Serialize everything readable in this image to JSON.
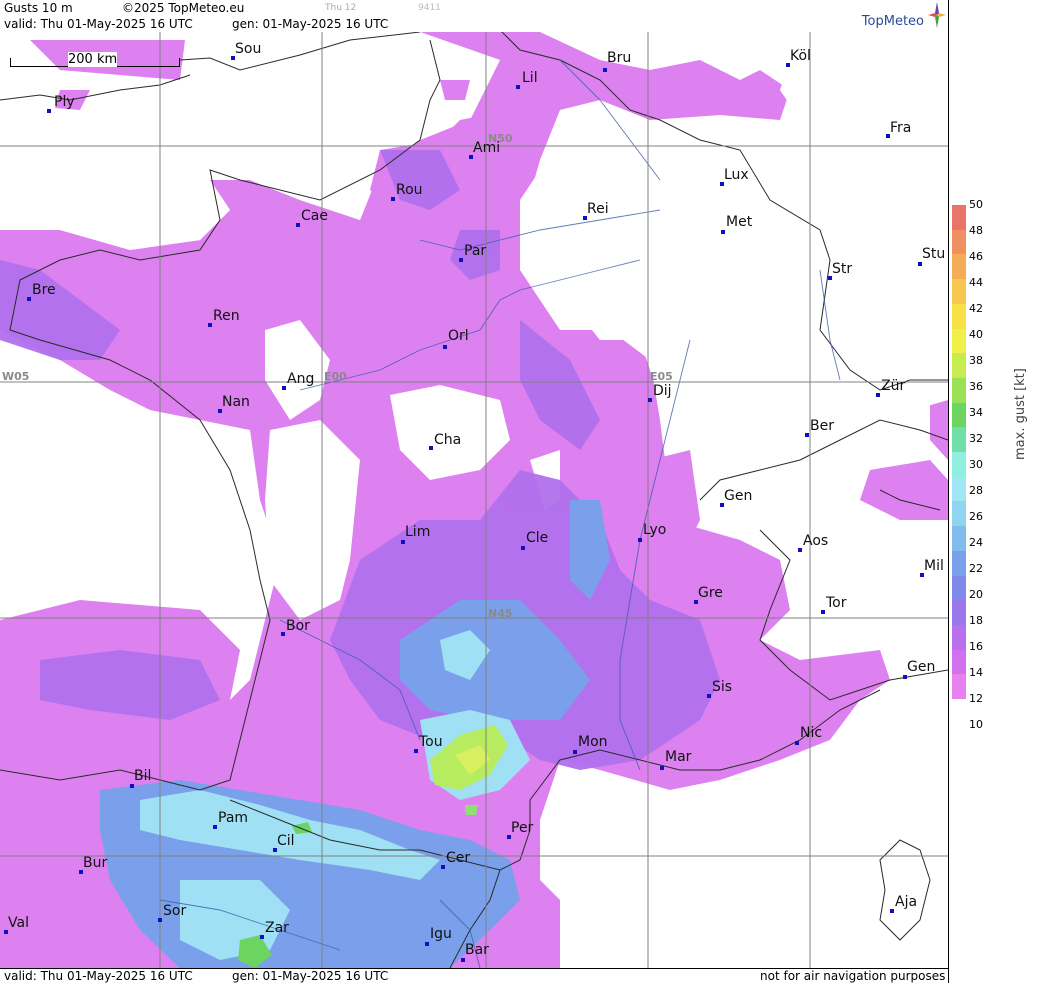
{
  "header": {
    "product": "Gusts 10 m",
    "copyright": "©2025 TopMeteo.eu",
    "faint1": "Thu 12",
    "faint2": "9411",
    "valid": "valid:  Thu  01-May-2025  16 UTC",
    "gen": "gen: 01-May-2025 16 UTC",
    "logo": "TopMeteo"
  },
  "footer": {
    "valid": "valid:  Thu  01-May-2025  16 UTC",
    "gen": "gen: 01-May-2025 16 UTC",
    "disclaimer": "not for air navigation purposes"
  },
  "scale_bar": "200 km",
  "grid_labels": [
    "N50",
    "N45",
    "W05",
    "E00",
    "E05"
  ],
  "cities": [
    "Sou",
    "Bru",
    "Köl",
    "Ply",
    "Lil",
    "Fra",
    "Ami",
    "Lux",
    "Rou",
    "Cae",
    "Rei",
    "Met",
    "Par",
    "Stu",
    "Bre",
    "Str",
    "Ren",
    "Orl",
    "Ang",
    "Dij",
    "Zür",
    "Nan",
    "Ber",
    "Cha",
    "Gen",
    "Lim",
    "Cle",
    "Lyo",
    "Aos",
    "Mil",
    "Gre",
    "Tor",
    "Bor",
    "Gen",
    "Sis",
    "Tou",
    "Mon",
    "Nic",
    "Mar",
    "Bil",
    "Pam",
    "Cil",
    "Per",
    "Cer",
    "Bur",
    "Sor",
    "Aja",
    "Val",
    "Zar",
    "Igu",
    "Bar"
  ],
  "legend": {
    "title": "max. gust  [kt]",
    "ticks": [
      "50",
      "48",
      "46",
      "44",
      "42",
      "40",
      "38",
      "36",
      "34",
      "32",
      "30",
      "28",
      "26",
      "24",
      "22",
      "20",
      "18",
      "16",
      "14",
      "12",
      "10"
    ],
    "colors": [
      "#e8746a",
      "#f09060",
      "#f4ac58",
      "#f6c850",
      "#f8e048",
      "#f0f048",
      "#c8ec50",
      "#9ce058",
      "#6cd460",
      "#70e0a8",
      "#90f0e0",
      "#a0e6f4",
      "#90d4f0",
      "#80bcee",
      "#7aa0ec",
      "#8088e8",
      "#9a78ec",
      "#b870ec",
      "#d270ee",
      "#e880f0"
    ]
  }
}
